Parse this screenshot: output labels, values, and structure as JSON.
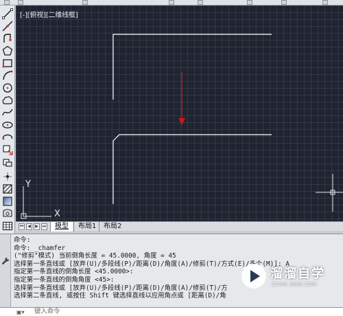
{
  "viewport": {
    "label": "[-][俯视][二维线框]"
  },
  "toolbar": {
    "tools": [
      {
        "icon": "line-icon"
      },
      {
        "icon": "construction-line-icon"
      },
      {
        "icon": "polyline-icon"
      },
      {
        "icon": "polygon-icon"
      },
      {
        "icon": "rectangle-icon"
      },
      {
        "icon": "arc-icon"
      },
      {
        "icon": "circle-icon"
      },
      {
        "icon": "revision-cloud-icon"
      },
      {
        "icon": "spline-icon"
      },
      {
        "icon": "ellipse-icon"
      },
      {
        "icon": "ellipse-arc-icon"
      },
      {
        "icon": "insert-block-icon"
      },
      {
        "icon": "make-block-icon"
      },
      {
        "icon": "point-icon"
      },
      {
        "icon": "hatch-icon"
      },
      {
        "icon": "gradient-icon"
      },
      {
        "icon": "region-icon"
      },
      {
        "icon": "table-icon"
      }
    ]
  },
  "ucs": {
    "x_label": "X",
    "y_label": "Y"
  },
  "layout_tabs": [
    {
      "label": "模型",
      "active": true
    },
    {
      "label": "布局1",
      "active": false
    },
    {
      "label": "布局2",
      "active": false
    }
  ],
  "command_history": [
    "命令:",
    "命令: _chamfer",
    "(\"修剪\"模式) 当前倒角长度 = 45.0000, 角度 = 45",
    "选择第一条直线或 [放弃(U)/多段线(P)/距离(D)/角度(A)/修剪(T)/方式(E)/多个(M)]:  A",
    "指定第一条直线的倒角长度 <45.0000>:",
    "指定第一条直线的倒角角度 <45>:",
    "选择第一条直线或 [放弃(U)/多段线(P)/距离(D)/角度(A)/修剪(T)/方",
    "选择第二条直线, 或按住 Shift 键选择直线以应用角点或 [距离(D)/角"
  ],
  "command_input": {
    "placeholder": "键入命令"
  },
  "watermark": {
    "brand": "溜溜自学",
    "site": "ZIXUE.3066.COM"
  },
  "colors": {
    "canvas_bg": "#1f2430",
    "drawing_lines": "#ffffff",
    "arrow": "#d0141c"
  }
}
